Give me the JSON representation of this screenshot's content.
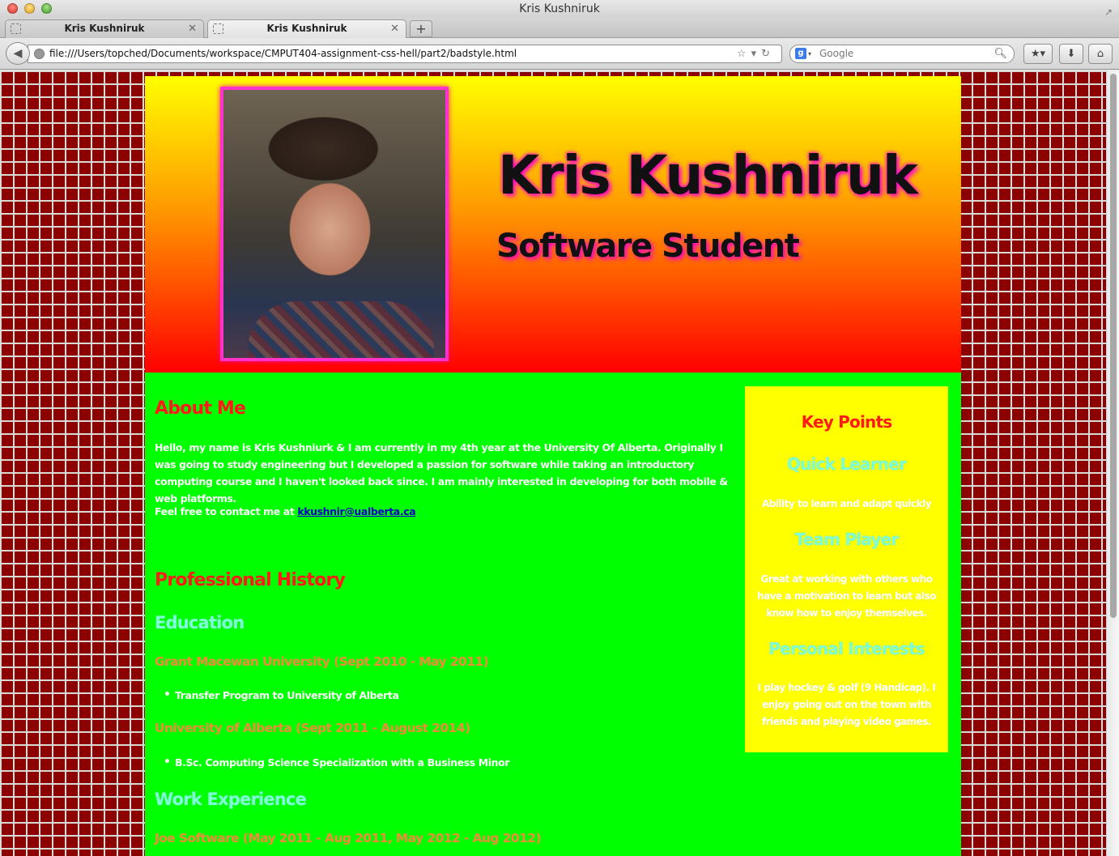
{
  "window": {
    "title": "Kris Kushniruk"
  },
  "tabs": [
    {
      "label": "Kris Kushniruk"
    },
    {
      "label": "Kris Kushniruk"
    }
  ],
  "toolbar": {
    "new_tab_label": "+",
    "url": "file:///Users/topched/Documents/workspace/CMPUT404-assignment-css-hell/part2/badstyle.html",
    "search_placeholder": "Google"
  },
  "header": {
    "name": "Kris Kushniruk",
    "subtitle": "Software Student"
  },
  "about": {
    "heading": "About Me",
    "paragraph": "Hello, my name is Kris Kushniurk & I am currently in my 4th year at the University Of Alberta. Originally I was going to study engineering but I developed a passion for software while taking an introductory computing course and I haven't looked back since. I am mainly interested in developing for both mobile & web platforms.",
    "contact_prefix": "Feel free to contact me at ",
    "email": "kkushnir@ualberta.ca"
  },
  "history": {
    "heading": "Professional History",
    "education_heading": "Education",
    "education": [
      {
        "institution": "Grant Macewan University (Sept 2010 - May 2011)",
        "item": "Transfer Program to University of Alberta"
      },
      {
        "institution": "University of Alberta (Sept 2011 - August 2014)",
        "item": "B.Sc. Computing Science Specialization with a Business Minor"
      }
    ],
    "work_heading": "Work Experience",
    "work": [
      {
        "employer": "Joe Software (May 2011 - Aug 2011, May 2012 - Aug 2012)"
      }
    ]
  },
  "sidebar": {
    "title": "Key Points",
    "points": [
      {
        "heading": "Quick Learner",
        "text": "Ability to learn and adapt quickly"
      },
      {
        "heading": "Team Player",
        "text": "Great at working with others who have a motivation to learn but also know how to enjoy themselves."
      },
      {
        "heading": "Personal Interests",
        "text": "I play hockey & golf (9 Handicap). I enjoy going out on the town with friends and playing video games."
      }
    ]
  },
  "colors": {
    "page_bg": "#8b0000",
    "header_top": "#ffff00",
    "header_bottom": "#ff0000",
    "content_bg": "#00ff00",
    "sidebar_bg": "#ffff00",
    "heading_red": "#ff1a1a",
    "heading_cyan": "#7fffd4",
    "heading_orange": "#f08a3c",
    "photo_border": "#ff33cc"
  }
}
